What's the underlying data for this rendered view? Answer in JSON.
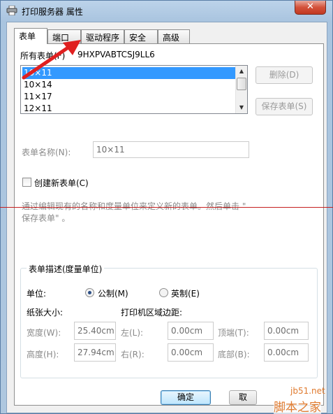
{
  "window": {
    "title": "打印服务器 属性",
    "close_glyph": "✕"
  },
  "tabs": [
    {
      "label": "表单"
    },
    {
      "label": "端口"
    },
    {
      "label": "驱动程序"
    },
    {
      "label": "安全"
    },
    {
      "label": "高级"
    }
  ],
  "forms": {
    "all_forms_label": "所有表单(F)",
    "server_name": "9HXPVABTCSJ9LL6",
    "items": [
      "10×11",
      "10×14",
      "11×17",
      "12×11"
    ],
    "selected_index": 0,
    "delete_button": "删除(D)",
    "save_button": "保存表单(S)",
    "form_name_label": "表单名称(N):",
    "form_name_value": "10×11",
    "create_new_label": "创建新表单(C)",
    "description_line1": "通过编辑现有的名称和度量单位来定义新的表单。然后单击 \"",
    "description_line2": "保存表单\" 。"
  },
  "form_desc": {
    "group_title": "表单描述(度量单位)",
    "unit_label": "单位:",
    "metric_label": "公制(M)",
    "imperial_label": "英制(E)",
    "paper_size_label": "纸张大小:",
    "margins_label": "打印机区域边距:",
    "width_label": "宽度(W):",
    "width_value": "25.40cm",
    "height_label": "高度(H):",
    "height_value": "27.94cm",
    "left_label": "左(L):",
    "left_value": "0.00cm",
    "right_label": "右(R):",
    "right_value": "0.00cm",
    "top_label": "顶端(T):",
    "top_value": "0.00cm",
    "bottom_label": "底部(B):",
    "bottom_value": "0.00cm"
  },
  "footer": {
    "ok_button": "确定",
    "cancel_button": "取"
  },
  "watermark": {
    "url": "jb51.net",
    "name": "脚本之家"
  },
  "colors": {
    "selection": "#3399ff",
    "annotation_red": "#e02020"
  }
}
